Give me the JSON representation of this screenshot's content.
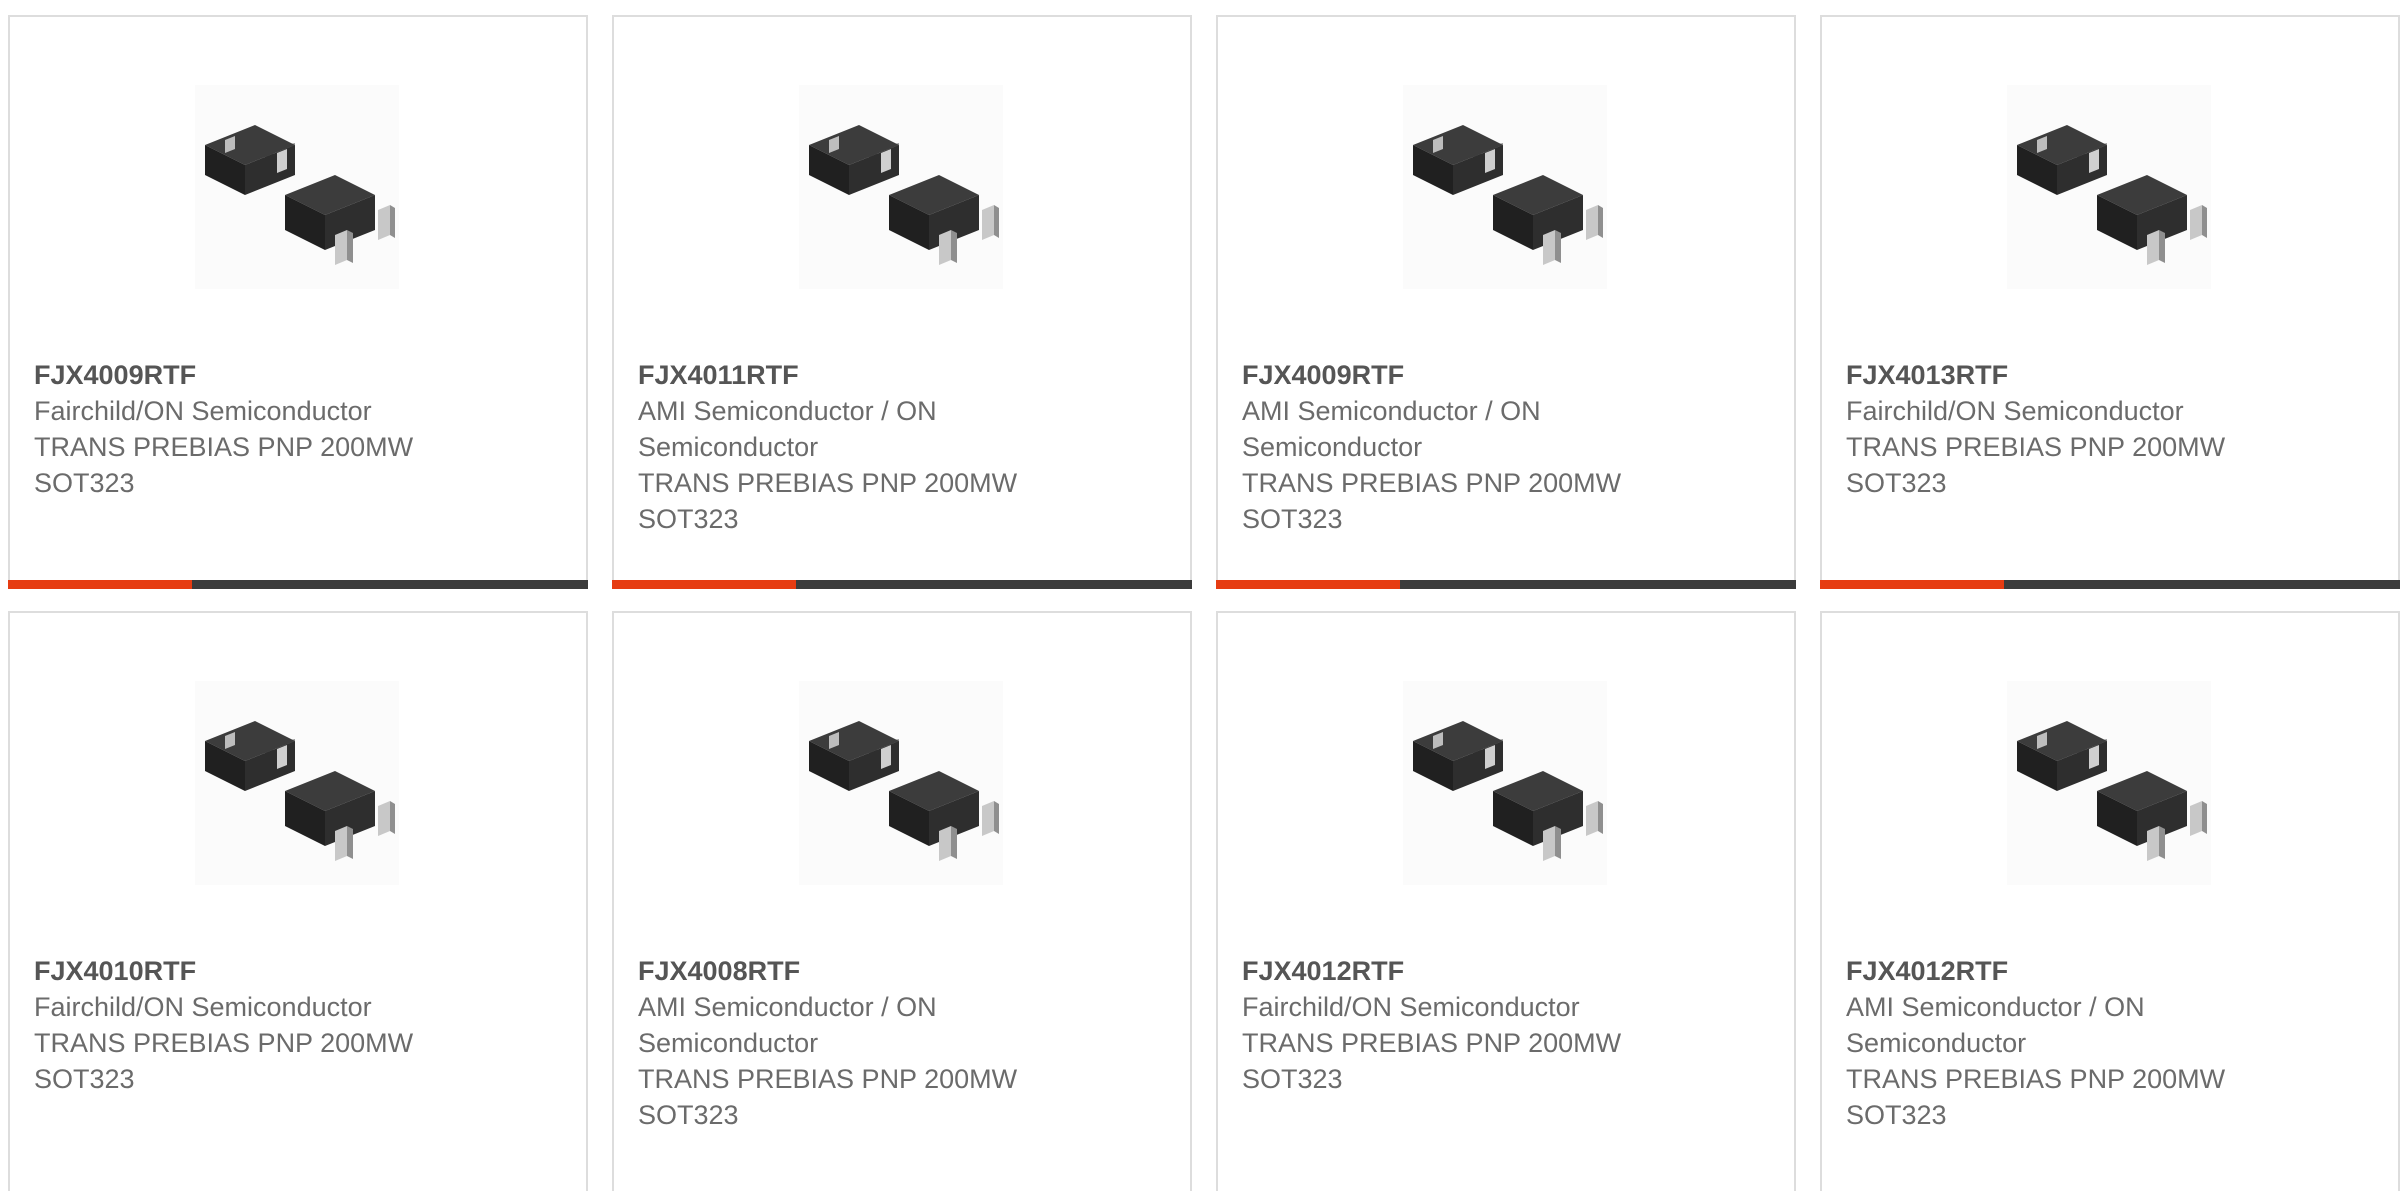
{
  "products": [
    {
      "part_number": "FJX4009RTF",
      "manufacturer": "Fairchild/ON Semiconductor",
      "description": "TRANS PREBIAS PNP 200MW SOT323",
      "image_icon": "sot323-transistor-icon"
    },
    {
      "part_number": "FJX4011RTF",
      "manufacturer": "AMI Semiconductor / ON Semiconductor",
      "description": "TRANS PREBIAS PNP 200MW SOT323",
      "image_icon": "sot323-transistor-icon"
    },
    {
      "part_number": "FJX4009RTF",
      "manufacturer": "AMI Semiconductor / ON Semiconductor",
      "description": "TRANS PREBIAS PNP 200MW SOT323",
      "image_icon": "sot323-transistor-icon"
    },
    {
      "part_number": "FJX4013RTF",
      "manufacturer": "Fairchild/ON Semiconductor",
      "description": "TRANS PREBIAS PNP 200MW SOT323",
      "image_icon": "sot323-transistor-icon"
    },
    {
      "part_number": "FJX4010RTF",
      "manufacturer": "Fairchild/ON Semiconductor",
      "description": "TRANS PREBIAS PNP 200MW SOT323",
      "image_icon": "sot323-transistor-icon"
    },
    {
      "part_number": "FJX4008RTF",
      "manufacturer": "AMI Semiconductor / ON Semiconductor",
      "description": "TRANS PREBIAS PNP 200MW SOT323",
      "image_icon": "sot323-transistor-icon"
    },
    {
      "part_number": "FJX4012RTF",
      "manufacturer": "Fairchild/ON Semiconductor",
      "description": "TRANS PREBIAS PNP 200MW SOT323",
      "image_icon": "sot323-transistor-icon"
    },
    {
      "part_number": "FJX4012RTF",
      "manufacturer": "AMI Semiconductor / ON Semiconductor",
      "description": "TRANS PREBIAS PNP 200MW SOT323",
      "image_icon": "sot323-transistor-icon"
    }
  ],
  "colors": {
    "accent": "#e63c12",
    "bar": "#3b3b3b",
    "card_border": "#dddddd",
    "text": "#6b6b6b"
  }
}
